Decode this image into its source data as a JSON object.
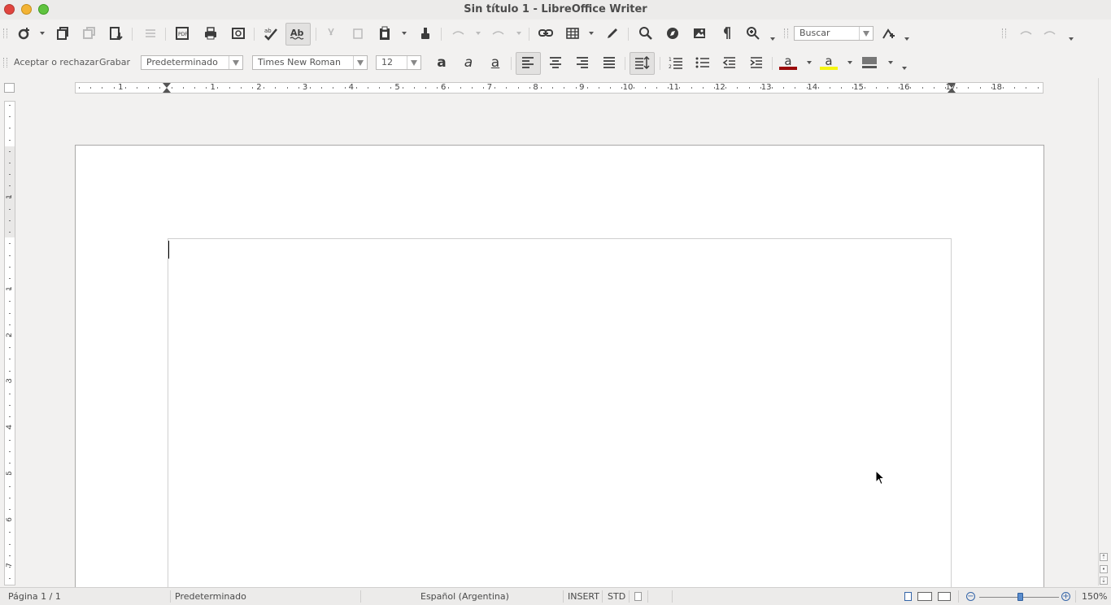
{
  "window": {
    "title": "Sin título 1 - LibreOffice Writer"
  },
  "toolbar_standard": {
    "search_placeholder": "Buscar",
    "icons": [
      "new-document",
      "open",
      "save-disabled",
      "export",
      "pdf",
      "print",
      "print-preview",
      "spellcheck",
      "autospell",
      "cut",
      "copy",
      "paste",
      "clone-formatting",
      "undo",
      "redo",
      "hyperlink",
      "table",
      "draw",
      "find",
      "navigator",
      "image",
      "formatting-marks",
      "zoom",
      "special-character"
    ]
  },
  "toolbar_formatting": {
    "track_changes_label": "Aceptar o rechazar",
    "record_label": "Grabar",
    "paragraph_style": "Predeterminado",
    "font_name": "Times New Roman",
    "font_size": "12",
    "bold_glyph": "a",
    "italic_glyph": "a",
    "underline_glyph": "a",
    "font_color_glyph": "a",
    "highlight_glyph": "a",
    "colors": {
      "font_color": "#9b0b0b",
      "highlight": "#f5f513"
    }
  },
  "ruler": {
    "h_labels": [
      "1",
      "1",
      "2",
      "3",
      "4",
      "5",
      "6",
      "7",
      "8",
      "9",
      "10",
      "11",
      "12",
      "13",
      "14",
      "15",
      "16",
      "17",
      "18"
    ],
    "v_labels": [
      "1",
      "1",
      "2",
      "3",
      "4",
      "5",
      "6",
      "7"
    ]
  },
  "status": {
    "page": "Página  1 / 1",
    "style": "Predeterminado",
    "language": "Español (Argentina)",
    "insert_mode": "INSERT",
    "selection_mode": "STD",
    "zoom": "150%",
    "zoom_percent": 150
  }
}
